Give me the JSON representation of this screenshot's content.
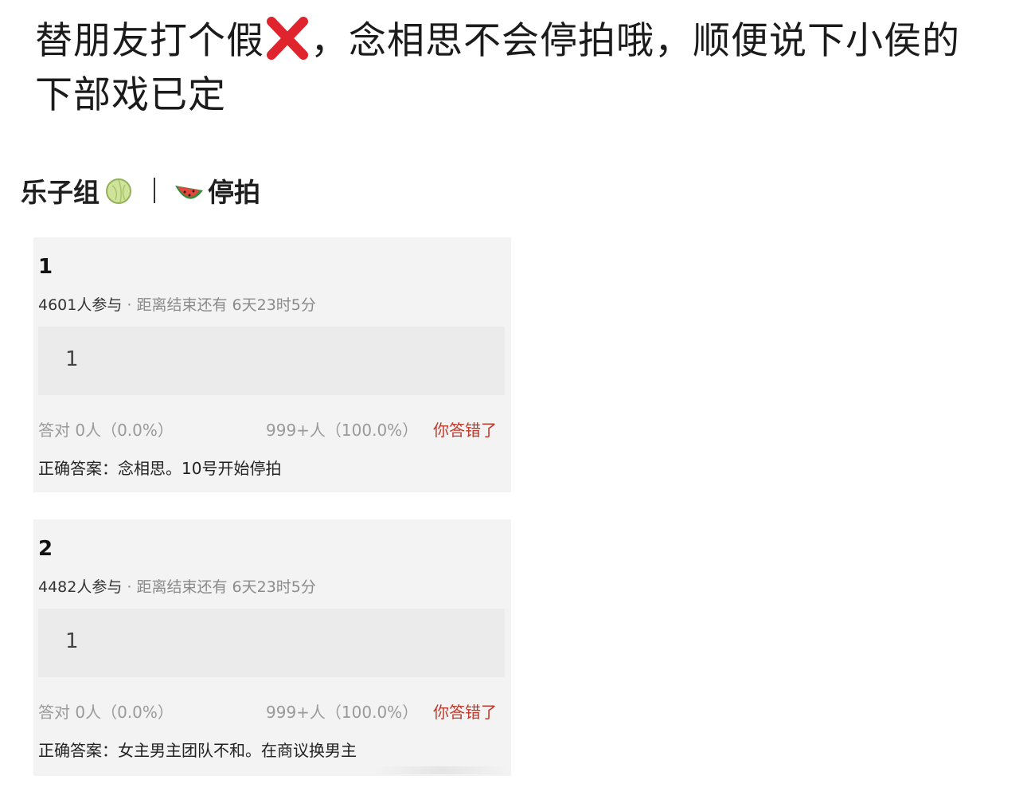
{
  "post": {
    "text_before_icon": "替朋友打个假",
    "text_after_icon": "，念相思不会停拍哦，顺便说下小侯的下部戏已定",
    "cross_icon": "red-cross-mark-icon"
  },
  "screenshot": {
    "header": {
      "group_name": "乐子组",
      "melon_icon": "melon-icon",
      "watermelon_icon": "watermelon-icon",
      "topic": "停拍"
    },
    "questions": [
      {
        "number": "1",
        "participants": "4601人参与",
        "separator": " · ",
        "deadline": "距离结束还有 6天23时5分",
        "answer": "1",
        "correct_stat": "答对  0人（0.0%）",
        "other_stat": "999+人（100.0%）",
        "result": "你答错了",
        "correct_answer": "正确答案：念相思。10号开始停拍"
      },
      {
        "number": "2",
        "participants": "4482人参与",
        "separator": " · ",
        "deadline": "距离结束还有 6天23时5分",
        "answer": "1",
        "correct_stat": "答对  0人（0.0%）",
        "other_stat": "999+人（100.0%）",
        "result": "你答错了",
        "correct_answer": "正确答案：女主男主团队不和。在商议换男主"
      }
    ]
  },
  "colors": {
    "wrong_answer": "#c0392b",
    "card_background": "#f3f3f3",
    "cross_icon": "#e0242e"
  }
}
